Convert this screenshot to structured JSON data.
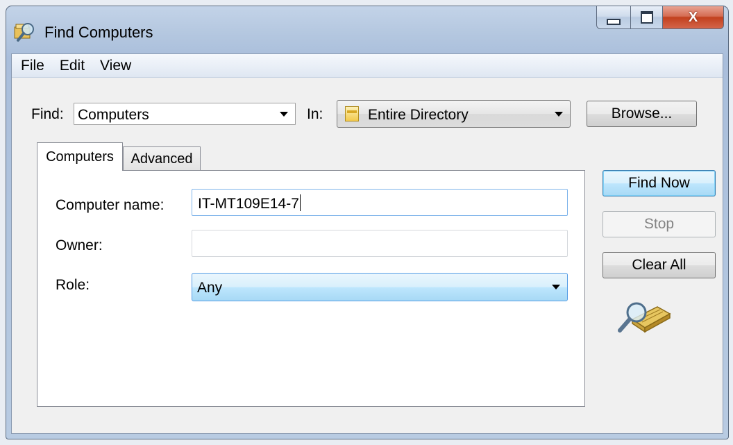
{
  "window": {
    "title": "Find Computers",
    "icon": "find-computers-icon"
  },
  "caption_buttons": {
    "close_glyph": "X"
  },
  "menu": [
    {
      "label": "File"
    },
    {
      "label": "Edit"
    },
    {
      "label": "View"
    }
  ],
  "find": {
    "label": "Find:",
    "value": "Computers"
  },
  "in": {
    "label": "In:",
    "value": "Entire Directory",
    "icon": "folder-icon"
  },
  "browse_label": "Browse...",
  "tabs": [
    {
      "label": "Computers",
      "active": true
    },
    {
      "label": "Advanced",
      "active": false
    }
  ],
  "form": {
    "computer_name_label": "Computer name:",
    "computer_name_value": "IT-MT109E14-7",
    "owner_label": "Owner:",
    "owner_value": "",
    "role_label": "Role:",
    "role_value": "Any"
  },
  "actions": {
    "find_now": "Find Now",
    "stop": "Stop",
    "clear_all": "Clear All"
  },
  "decorations": {
    "search_graphic": "magnifier-over-tray-icon"
  }
}
